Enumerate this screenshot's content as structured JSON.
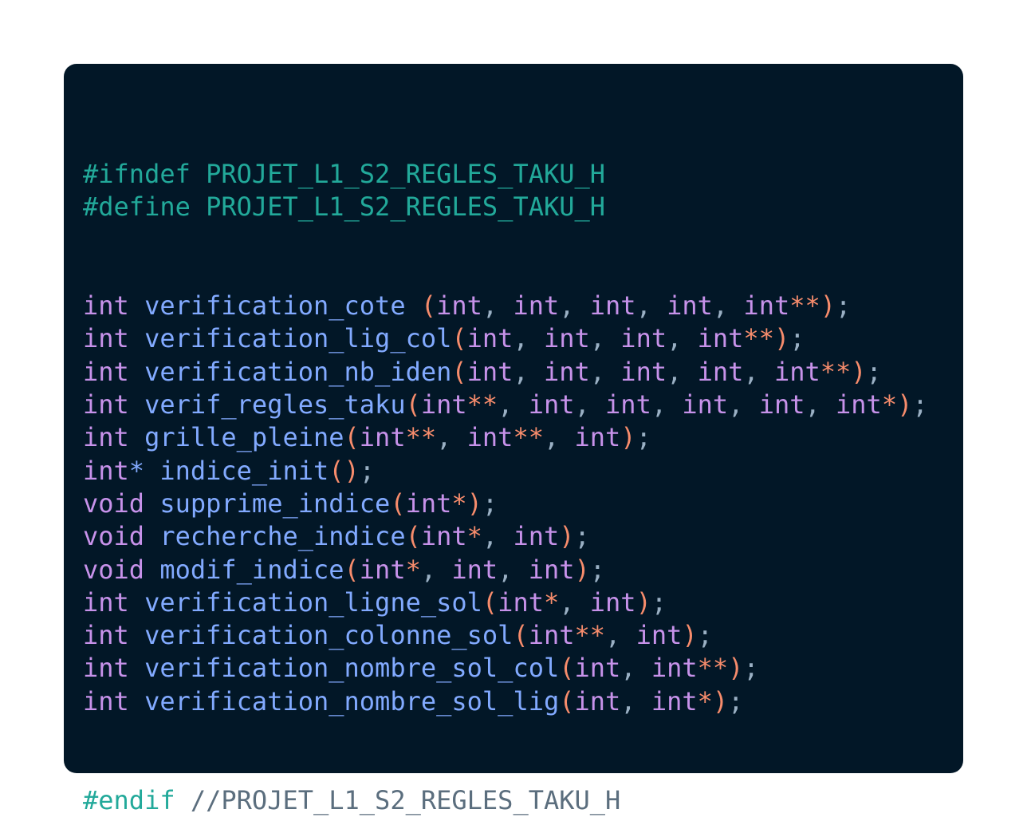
{
  "editor": {
    "theme": {
      "background": "#021727",
      "directive": "#22a99a",
      "type": "#c792ea",
      "function": "#82aaff",
      "operator": "#f78c6c",
      "punctuation": "#9ab0c4",
      "comment": "#5b6e7e"
    },
    "lines": [
      [
        [
          "directive",
          "#ifndef"
        ],
        [
          "space",
          " "
        ],
        [
          "macro",
          "PROJET_L1_S2_REGLES_TAKU_H"
        ]
      ],
      [
        [
          "directive",
          "#define"
        ],
        [
          "space",
          " "
        ],
        [
          "macro",
          "PROJET_L1_S2_REGLES_TAKU_H"
        ]
      ],
      [],
      [],
      [
        [
          "type",
          "int"
        ],
        [
          "space",
          " "
        ],
        [
          "func",
          "verification_cote"
        ],
        [
          "space",
          " "
        ],
        [
          "paren",
          "("
        ],
        [
          "type",
          "int"
        ],
        [
          "punct",
          ","
        ],
        [
          "space",
          " "
        ],
        [
          "type",
          "int"
        ],
        [
          "punct",
          ","
        ],
        [
          "space",
          " "
        ],
        [
          "type",
          "int"
        ],
        [
          "punct",
          ","
        ],
        [
          "space",
          " "
        ],
        [
          "type",
          "int"
        ],
        [
          "punct",
          ","
        ],
        [
          "space",
          " "
        ],
        [
          "type",
          "int"
        ],
        [
          "star",
          "**"
        ],
        [
          "paren",
          ")"
        ],
        [
          "punct",
          ";"
        ]
      ],
      [
        [
          "type",
          "int"
        ],
        [
          "space",
          " "
        ],
        [
          "func",
          "verification_lig_col"
        ],
        [
          "paren",
          "("
        ],
        [
          "type",
          "int"
        ],
        [
          "punct",
          ","
        ],
        [
          "space",
          " "
        ],
        [
          "type",
          "int"
        ],
        [
          "punct",
          ","
        ],
        [
          "space",
          " "
        ],
        [
          "type",
          "int"
        ],
        [
          "punct",
          ","
        ],
        [
          "space",
          " "
        ],
        [
          "type",
          "int"
        ],
        [
          "star",
          "**"
        ],
        [
          "paren",
          ")"
        ],
        [
          "punct",
          ";"
        ]
      ],
      [
        [
          "type",
          "int"
        ],
        [
          "space",
          " "
        ],
        [
          "func",
          "verification_nb_iden"
        ],
        [
          "paren",
          "("
        ],
        [
          "type",
          "int"
        ],
        [
          "punct",
          ","
        ],
        [
          "space",
          " "
        ],
        [
          "type",
          "int"
        ],
        [
          "punct",
          ","
        ],
        [
          "space",
          " "
        ],
        [
          "type",
          "int"
        ],
        [
          "punct",
          ","
        ],
        [
          "space",
          " "
        ],
        [
          "type",
          "int"
        ],
        [
          "punct",
          ","
        ],
        [
          "space",
          " "
        ],
        [
          "type",
          "int"
        ],
        [
          "star",
          "**"
        ],
        [
          "paren",
          ")"
        ],
        [
          "punct",
          ";"
        ]
      ],
      [
        [
          "type",
          "int"
        ],
        [
          "space",
          " "
        ],
        [
          "func",
          "verif_regles_taku"
        ],
        [
          "paren",
          "("
        ],
        [
          "type",
          "int"
        ],
        [
          "star",
          "**"
        ],
        [
          "punct",
          ","
        ],
        [
          "space",
          " "
        ],
        [
          "type",
          "int"
        ],
        [
          "punct",
          ","
        ],
        [
          "space",
          " "
        ],
        [
          "type",
          "int"
        ],
        [
          "punct",
          ","
        ],
        [
          "space",
          " "
        ],
        [
          "type",
          "int"
        ],
        [
          "punct",
          ","
        ],
        [
          "space",
          " "
        ],
        [
          "type",
          "int"
        ],
        [
          "punct",
          ","
        ],
        [
          "space",
          " "
        ],
        [
          "type",
          "int"
        ],
        [
          "star",
          "*"
        ],
        [
          "paren",
          ")"
        ],
        [
          "punct",
          ";"
        ]
      ],
      [
        [
          "type",
          "int"
        ],
        [
          "space",
          " "
        ],
        [
          "func",
          "grille_pleine"
        ],
        [
          "paren",
          "("
        ],
        [
          "type",
          "int"
        ],
        [
          "star",
          "**"
        ],
        [
          "punct",
          ","
        ],
        [
          "space",
          " "
        ],
        [
          "type",
          "int"
        ],
        [
          "star",
          "**"
        ],
        [
          "punct",
          ","
        ],
        [
          "space",
          " "
        ],
        [
          "type",
          "int"
        ],
        [
          "paren",
          ")"
        ],
        [
          "punct",
          ";"
        ]
      ],
      [
        [
          "type",
          "int"
        ],
        [
          "func",
          "*"
        ],
        [
          "space",
          " "
        ],
        [
          "func",
          "indice_init"
        ],
        [
          "paren",
          "()"
        ],
        [
          "punct",
          ";"
        ]
      ],
      [
        [
          "type",
          "void"
        ],
        [
          "space",
          " "
        ],
        [
          "func",
          "supprime_indice"
        ],
        [
          "paren",
          "("
        ],
        [
          "type",
          "int"
        ],
        [
          "star",
          "*"
        ],
        [
          "paren",
          ")"
        ],
        [
          "punct",
          ";"
        ]
      ],
      [
        [
          "type",
          "void"
        ],
        [
          "space",
          " "
        ],
        [
          "func",
          "recherche_indice"
        ],
        [
          "paren",
          "("
        ],
        [
          "type",
          "int"
        ],
        [
          "star",
          "*"
        ],
        [
          "punct",
          ","
        ],
        [
          "space",
          " "
        ],
        [
          "type",
          "int"
        ],
        [
          "paren",
          ")"
        ],
        [
          "punct",
          ";"
        ]
      ],
      [
        [
          "type",
          "void"
        ],
        [
          "space",
          " "
        ],
        [
          "func",
          "modif_indice"
        ],
        [
          "paren",
          "("
        ],
        [
          "type",
          "int"
        ],
        [
          "star",
          "*"
        ],
        [
          "punct",
          ","
        ],
        [
          "space",
          " "
        ],
        [
          "type",
          "int"
        ],
        [
          "punct",
          ","
        ],
        [
          "space",
          " "
        ],
        [
          "type",
          "int"
        ],
        [
          "paren",
          ")"
        ],
        [
          "punct",
          ";"
        ]
      ],
      [
        [
          "type",
          "int"
        ],
        [
          "space",
          " "
        ],
        [
          "func",
          "verification_ligne_sol"
        ],
        [
          "paren",
          "("
        ],
        [
          "type",
          "int"
        ],
        [
          "star",
          "*"
        ],
        [
          "punct",
          ","
        ],
        [
          "space",
          " "
        ],
        [
          "type",
          "int"
        ],
        [
          "paren",
          ")"
        ],
        [
          "punct",
          ";"
        ]
      ],
      [
        [
          "type",
          "int"
        ],
        [
          "space",
          " "
        ],
        [
          "func",
          "verification_colonne_sol"
        ],
        [
          "paren",
          "("
        ],
        [
          "type",
          "int"
        ],
        [
          "star",
          "**"
        ],
        [
          "punct",
          ","
        ],
        [
          "space",
          " "
        ],
        [
          "type",
          "int"
        ],
        [
          "paren",
          ")"
        ],
        [
          "punct",
          ";"
        ]
      ],
      [
        [
          "type",
          "int"
        ],
        [
          "space",
          " "
        ],
        [
          "func",
          "verification_nombre_sol_col"
        ],
        [
          "paren",
          "("
        ],
        [
          "type",
          "int"
        ],
        [
          "punct",
          ","
        ],
        [
          "space",
          " "
        ],
        [
          "type",
          "int"
        ],
        [
          "star",
          "**"
        ],
        [
          "paren",
          ")"
        ],
        [
          "punct",
          ";"
        ]
      ],
      [
        [
          "type",
          "int"
        ],
        [
          "space",
          " "
        ],
        [
          "func",
          "verification_nombre_sol_lig"
        ],
        [
          "paren",
          "("
        ],
        [
          "type",
          "int"
        ],
        [
          "punct",
          ","
        ],
        [
          "space",
          " "
        ],
        [
          "type",
          "int"
        ],
        [
          "star",
          "*"
        ],
        [
          "paren",
          ")"
        ],
        [
          "punct",
          ";"
        ]
      ],
      [],
      [],
      [
        [
          "directive",
          "#endif"
        ],
        [
          "space",
          " "
        ],
        [
          "comment",
          "//PROJET_L1_S2_REGLES_TAKU_H"
        ]
      ]
    ]
  }
}
